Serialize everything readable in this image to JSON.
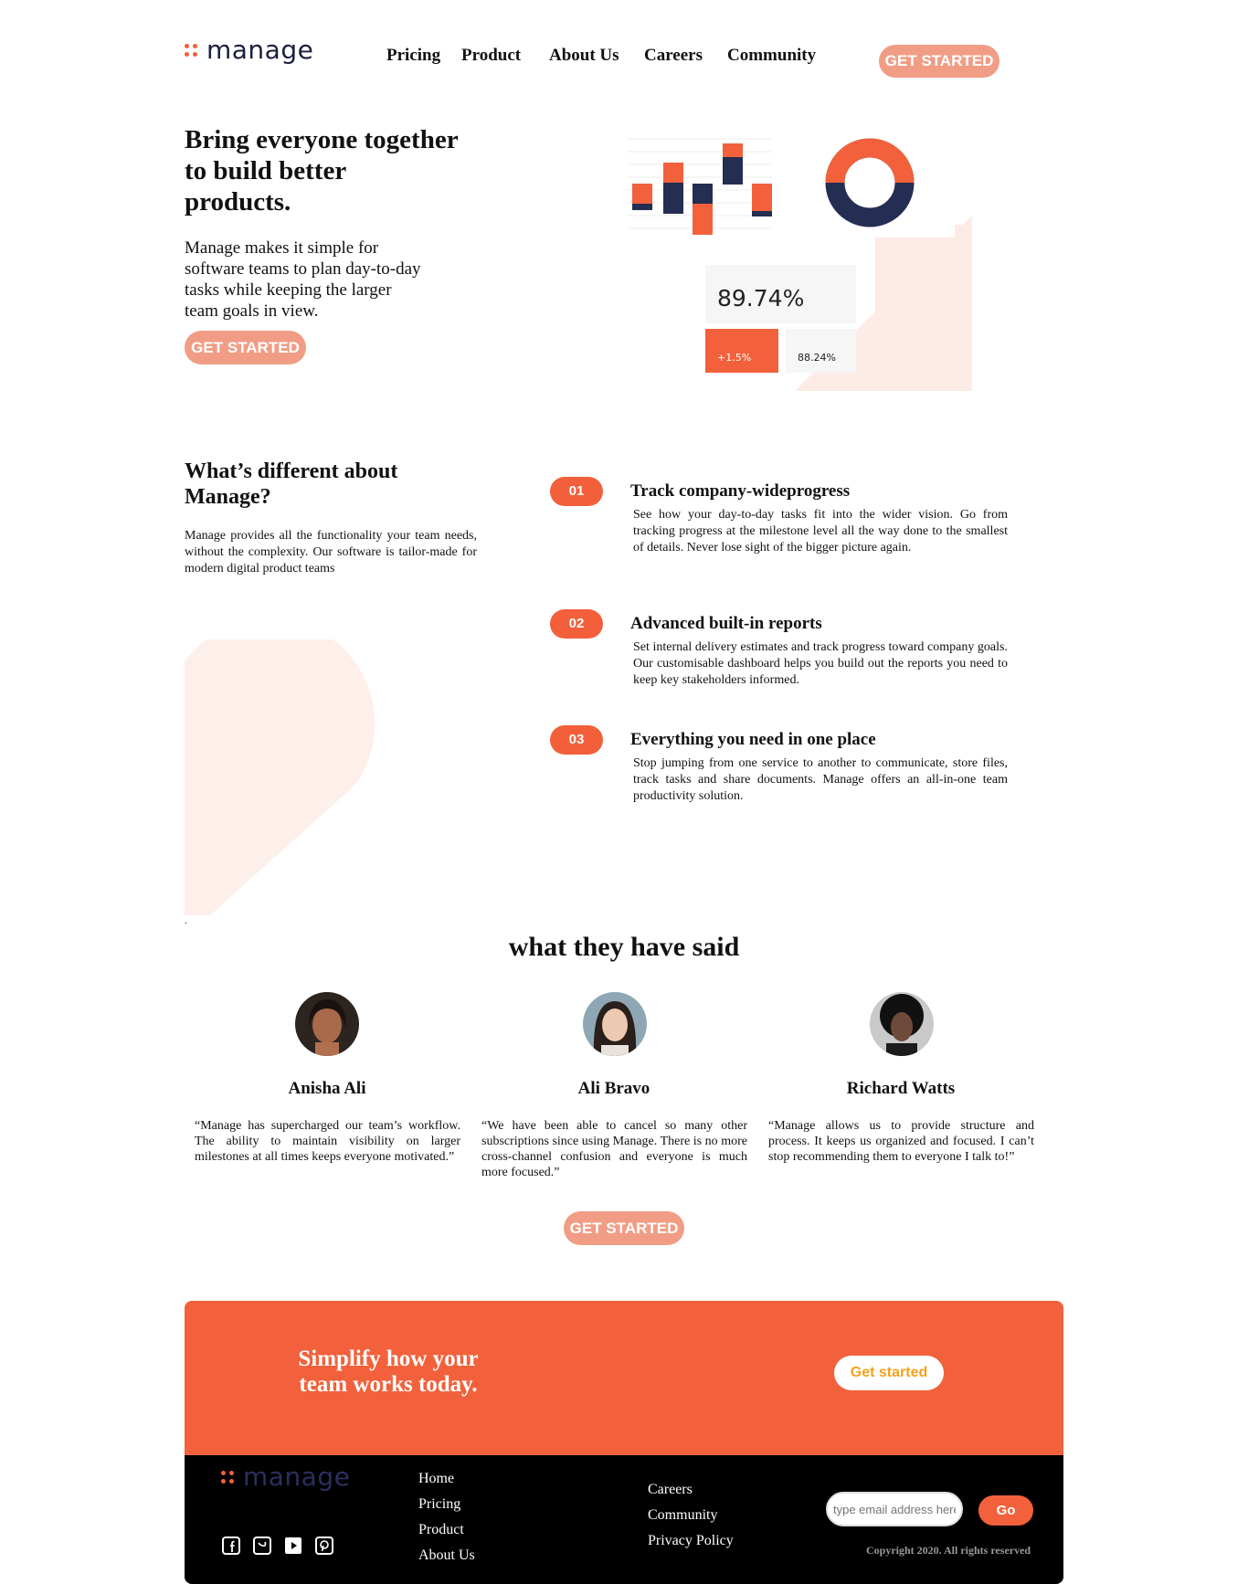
{
  "brand": {
    "name": "manage",
    "accent": "#f2613b",
    "dark": "#1d1e3f"
  },
  "nav": {
    "links": [
      "Pricing",
      "Product",
      "About Us",
      "Careers",
      "Community"
    ],
    "cta": "GET STARTED"
  },
  "hero": {
    "title": "Bring everyone together to build better products.",
    "description": "Manage makes it simple for software teams to plan day-to-day tasks while keeping the larger team goals in view.",
    "cta": "GET STARTED",
    "illustration": {
      "metric_main": "89.74%",
      "metric_change": "+1.5%",
      "metric_secondary": "88.24%"
    }
  },
  "different": {
    "title": "What’s different about Manage?",
    "description": "Manage provides all the functionality your team needs, without the complexity. Our software is tailor-made for modern digital product teams",
    "features": [
      {
        "num": "01",
        "title": "Track company-wideprogress",
        "desc": "See how your day-to-day tasks fit into the wider vision. Go from tracking progress at the milestone level all the way done to the smallest of details. Never lose sight of the bigger picture again."
      },
      {
        "num": "02",
        "title": "Advanced built-in reports",
        "desc": "Set internal delivery estimates and track progress toward company goals. Our customisable dashboard helps you build out the reports you need to keep key stakeholders informed."
      },
      {
        "num": "03",
        "title": "Everything you need in one place",
        "desc": "Stop jumping from one service to another to communicate, store files, track tasks and share documents. Manage offers an all-in-one team productivity solution."
      }
    ],
    "stray": "."
  },
  "testimonials": {
    "title": "what they have said",
    "items": [
      {
        "name": "Anisha Ali",
        "quote": "“Manage has supercharged our team’s workflow. The ability to maintain visibility on larger milestones at all times keeps everyone motivated.”"
      },
      {
        "name": "Ali Bravo",
        "quote": "“We have been able to cancel so many other subscriptions since using Manage. There is no more cross-channel confusion and everyone is much more focused.”"
      },
      {
        "name": "Richard Watts",
        "quote": "“Manage allows us to provide structure and process. It keeps us organized and focused. I can’t stop recommending them to everyone I talk to!”"
      }
    ],
    "cta": "GET STARTED"
  },
  "cta_band": {
    "title": "Simplify how your team works today.",
    "button": "Get started"
  },
  "footer": {
    "links_col1": [
      "Home",
      "Pricing",
      "Product",
      "About Us"
    ],
    "links_col2": [
      "Careers",
      "Community",
      "Privacy Policy"
    ],
    "social_icons": [
      "facebook-icon",
      "twitter-icon",
      "youtube-icon",
      "pinterest-icon"
    ],
    "email_placeholder": "type email address here",
    "go": "Go",
    "copyright": "Copyright 2020. All rights reserved"
  }
}
